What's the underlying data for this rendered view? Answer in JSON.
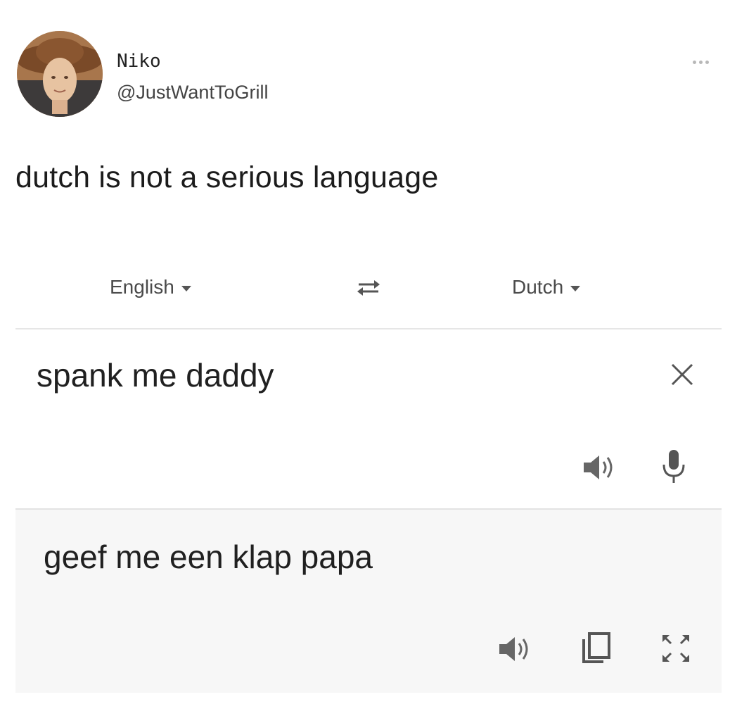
{
  "tweet": {
    "author_name": "Niko",
    "author_handle": "@JustWantToGrill",
    "text": "dutch is not a serious language",
    "more_icon": "more-horizontal-icon"
  },
  "translate": {
    "source_language": "English",
    "target_language": "Dutch",
    "swap_icon": "swap-arrows-icon",
    "source_text": "spank me daddy",
    "translated_text": "geef me een klap papa",
    "icons": {
      "clear": "close-icon",
      "source_speaker": "speaker-icon",
      "microphone": "microphone-icon",
      "target_speaker": "speaker-icon",
      "copy": "copy-icon",
      "fullscreen": "fullscreen-icon"
    }
  },
  "colors": {
    "text": "#1a1a1a",
    "muted": "#4a4a4a",
    "divider": "#e6e6e6",
    "output_bg": "#f7f7f7"
  }
}
